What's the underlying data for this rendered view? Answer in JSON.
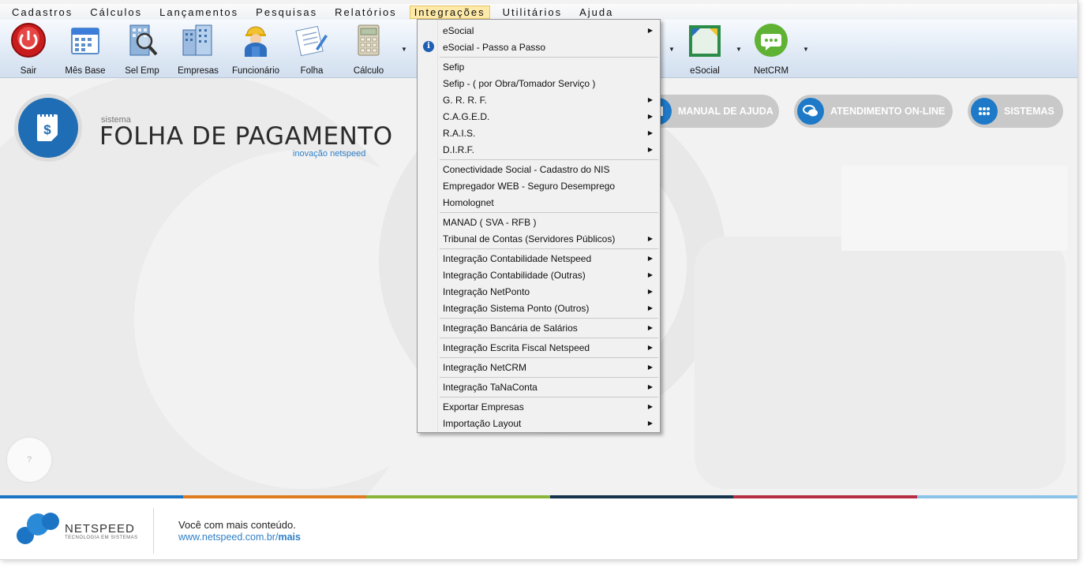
{
  "menubar": {
    "items": [
      "Cadastros",
      "Cálculos",
      "Lançamentos",
      "Pesquisas",
      "Relatórios",
      "Integrações",
      "Utilitários",
      "Ajuda"
    ],
    "active": "Integrações"
  },
  "toolbar": {
    "buttons": [
      "Sair",
      "Mês Base",
      "Sel Emp",
      "Empresas",
      "Funcionário",
      "Folha",
      "Cálculo",
      "eSocial",
      "NetCRM"
    ]
  },
  "header": {
    "system_small": "sistema",
    "title": "FOLHA DE PAGAMENTO",
    "subtitle": "inovação netspeed"
  },
  "pills": [
    "MANUAL DE AJUDA",
    "ATENDIMENTO ON-LINE",
    "SISTEMAS"
  ],
  "help_button": "?",
  "dropdown": {
    "items": [
      "eSocial",
      "eSocial - Passo a Passo",
      "Sefip",
      "Sefip - ( por Obra/Tomador Serviço )",
      "G. R. R. F.",
      "C.A.G.E.D.",
      "R.A.I.S.",
      "D.I.R.F.",
      "Conectividade Social - Cadastro do NIS",
      "Empregador WEB - Seguro Desemprego",
      "Homolognet",
      "MANAD ( SVA - RFB )",
      "Tribunal de Contas (Servidores Públicos)",
      "Integração Contabilidade Netspeed",
      "Integração Contabilidade (Outras)",
      "Integração NetPonto",
      "Integração Sistema Ponto (Outros)",
      "Integração Bancária de Salários",
      "Integração Escrita Fiscal Netspeed",
      "Integração NetCRM",
      "Integração TaNaConta",
      "Exportar Empresas",
      "Importação Layout"
    ]
  },
  "footer": {
    "brand": "NETSPEED",
    "brand_sub": "TECNOLOGIA EM SISTEMAS",
    "line1": "Você com mais conteúdo.",
    "line2_prefix": "www.netspeed.com.br/",
    "line2_bold": "mais"
  },
  "colors": {
    "accent_blue": "#1f6eb5",
    "stripe": [
      "#1b74c4",
      "#e07b20",
      "#8ab53a",
      "#15334c",
      "#b52e43",
      "#8cc3e8"
    ]
  }
}
